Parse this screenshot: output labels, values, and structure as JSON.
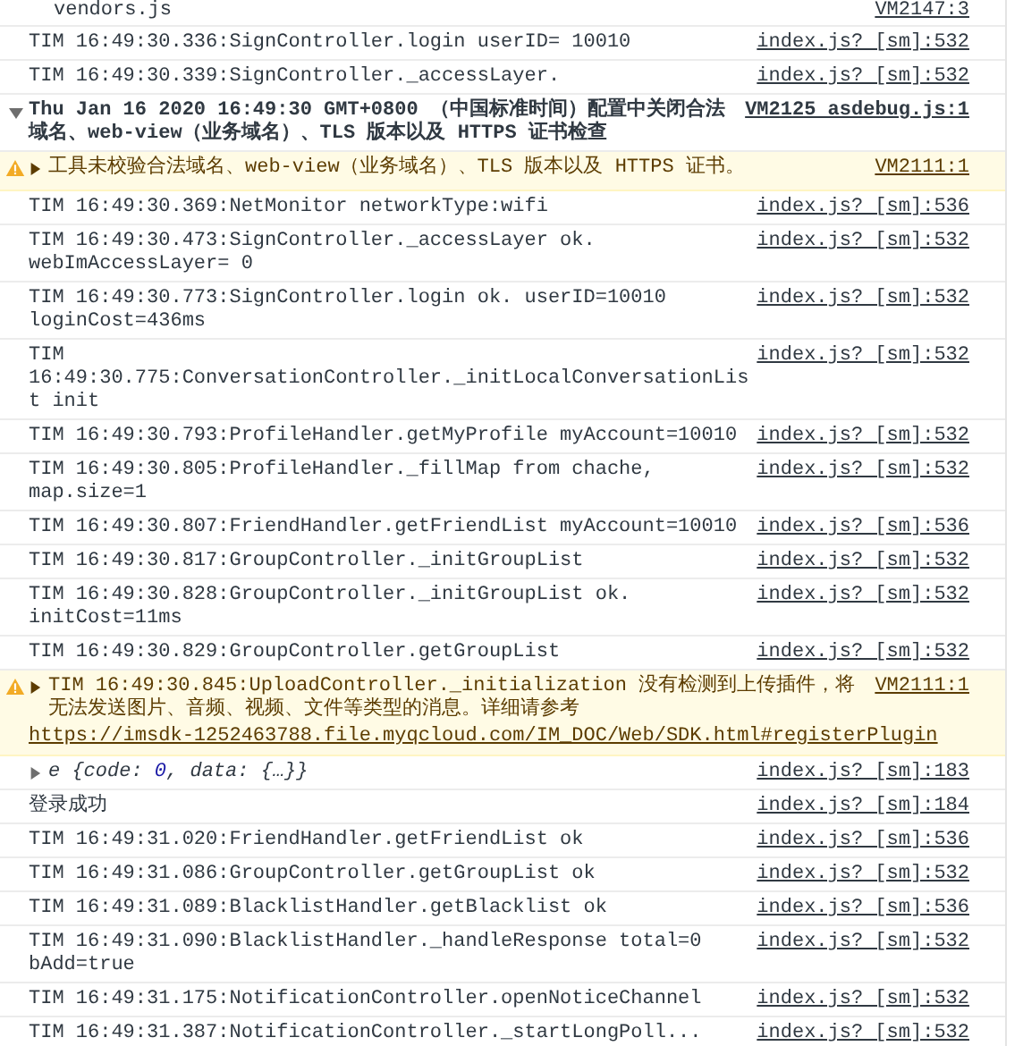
{
  "console": {
    "rows": [
      {
        "kind": "log",
        "text": "vendors.js",
        "source": "VM2147:3"
      },
      {
        "kind": "log",
        "text": "TIM 16:49:30.336:SignController.login userID= 10010",
        "source": "index.js? [sm]:532"
      },
      {
        "kind": "log",
        "text": "TIM 16:49:30.339:SignController._accessLayer.",
        "source": "index.js? [sm]:532"
      },
      {
        "kind": "group",
        "expanded": true,
        "text": "Thu Jan 16 2020 16:49:30 GMT+0800 （中国标准时间）配置中关闭合法域名、web-view（业务域名）、TLS 版本以及 HTTPS 证书检查",
        "source": "VM2125 asdebug.js:1"
      },
      {
        "kind": "warning",
        "expanded": false,
        "text": "工具未校验合法域名、web-view（业务域名）、TLS 版本以及 HTTPS 证书。",
        "source": "VM2111:1"
      },
      {
        "kind": "log",
        "text": "TIM 16:49:30.369:NetMonitor networkType:wifi",
        "source": "index.js? [sm]:536"
      },
      {
        "kind": "log",
        "text": "TIM 16:49:30.473:SignController._accessLayer ok. webImAccessLayer= 0",
        "source": "index.js? [sm]:532"
      },
      {
        "kind": "log",
        "text": "TIM 16:49:30.773:SignController.login ok. userID=10010 loginCost=436ms",
        "source": "index.js? [sm]:532"
      },
      {
        "kind": "log",
        "text": "TIM 16:49:30.775:ConversationController._initLocalConversationList init",
        "source": "index.js? [sm]:532"
      },
      {
        "kind": "log",
        "text": "TIM 16:49:30.793:ProfileHandler.getMyProfile myAccount=10010",
        "source": "index.js? [sm]:532"
      },
      {
        "kind": "log",
        "text": "TIM 16:49:30.805:ProfileHandler._fillMap from chache, map.size=1",
        "source": "index.js? [sm]:532"
      },
      {
        "kind": "log",
        "text": "TIM 16:49:30.807:FriendHandler.getFriendList myAccount=10010",
        "source": "index.js? [sm]:536"
      },
      {
        "kind": "log",
        "text": "TIM 16:49:30.817:GroupController._initGroupList",
        "source": "index.js? [sm]:532"
      },
      {
        "kind": "log",
        "text": "TIM 16:49:30.828:GroupController._initGroupList ok. initCost=11ms",
        "source": "index.js? [sm]:532"
      },
      {
        "kind": "log",
        "text": "TIM 16:49:30.829:GroupController.getGroupList",
        "source": "index.js? [sm]:532"
      },
      {
        "kind": "warning",
        "expanded": false,
        "text": "TIM 16:49:30.845:UploadController._initialization 没有检测到上传插件，将无法发送图片、音频、视频、文件等类型的消息。详细请参考 ",
        "link": "https://imsdk-1252463788.file.myqcloud.com/IM_DOC/Web/SDK.html#registerPlugin",
        "source": "VM2111:1"
      },
      {
        "kind": "object",
        "expanded": false,
        "parts": [
          {
            "kind": "plain",
            "text": "e {code: "
          },
          {
            "kind": "number",
            "text": "0"
          },
          {
            "kind": "plain",
            "text": ", data: {…}}"
          }
        ],
        "source": "index.js? [sm]:183"
      },
      {
        "kind": "log",
        "text": "登录成功",
        "source": "index.js? [sm]:184"
      },
      {
        "kind": "log",
        "text": "TIM 16:49:31.020:FriendHandler.getFriendList ok",
        "source": "index.js? [sm]:536"
      },
      {
        "kind": "log",
        "text": "TIM 16:49:31.086:GroupController.getGroupList ok",
        "source": "index.js? [sm]:532"
      },
      {
        "kind": "log",
        "text": "TIM 16:49:31.089:BlacklistHandler.getBlacklist ok",
        "source": "index.js? [sm]:536"
      },
      {
        "kind": "log",
        "text": "TIM 16:49:31.090:BlacklistHandler._handleResponse total=0 bAdd=true",
        "source": "index.js? [sm]:532"
      },
      {
        "kind": "log",
        "text": "TIM 16:49:31.175:NotificationController.openNoticeChannel",
        "source": "index.js? [sm]:532"
      },
      {
        "kind": "log",
        "text": "TIM 16:49:31.387:NotificationController._startLongPoll...",
        "source": "index.js? [sm]:532"
      }
    ]
  }
}
